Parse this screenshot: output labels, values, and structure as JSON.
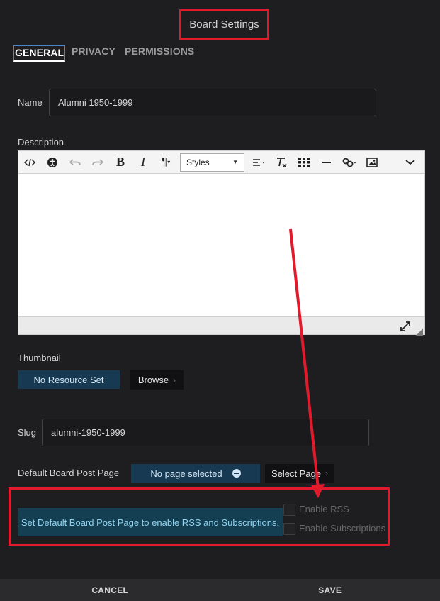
{
  "title": "Board Settings",
  "tabs": [
    {
      "label": "GENERAL",
      "active": true
    },
    {
      "label": "PRIVACY",
      "active": false
    },
    {
      "label": "PERMISSIONS",
      "active": false
    }
  ],
  "name": {
    "label": "Name",
    "value": "Alumni 1950-1999"
  },
  "description": {
    "label": "Description",
    "toolbar": {
      "styles_label": "Styles"
    }
  },
  "thumbnail": {
    "label": "Thumbnail",
    "resource_text": "No Resource Set",
    "browse_label": "Browse"
  },
  "slug": {
    "label": "Slug",
    "value": "alumni-1950-1999"
  },
  "default_page": {
    "label": "Default Board Post Page",
    "selected_text": "No page selected",
    "select_label": "Select Page"
  },
  "rss": {
    "info": "Set Default Board Post Page to enable RSS and Subscriptions.",
    "enable_rss": "Enable RSS",
    "enable_subscriptions": "Enable Subscriptions"
  },
  "footer": {
    "cancel": "CANCEL",
    "save": "SAVE"
  },
  "colors": {
    "annotation": "#e21b2c",
    "info_bg": "#143f52",
    "resource_bg": "#173a52"
  }
}
